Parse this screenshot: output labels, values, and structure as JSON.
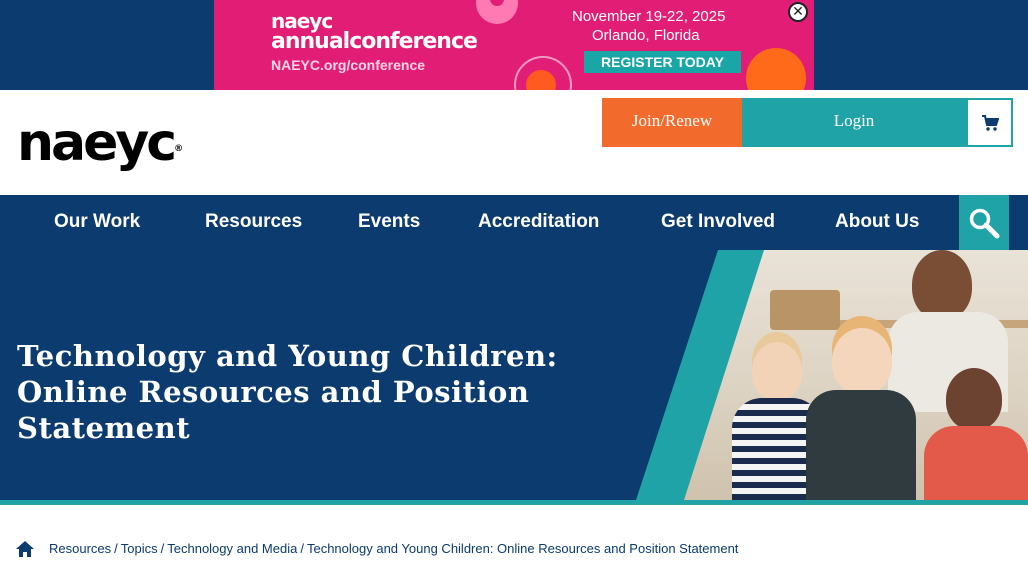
{
  "ad": {
    "brand_line1": "naeyc",
    "brand_line2_bold": "annual",
    "brand_line2_rest": "conference",
    "url": "NAEYC.org/conference",
    "date": "November 19-22, 2025",
    "location": "Orlando, Florida",
    "cta": "REGISTER TODAY",
    "close_glyph": "✕",
    "colors": {
      "bg": "#e21d75",
      "cta": "#1aa6a7"
    }
  },
  "header": {
    "brand": "naeyc",
    "brand_mark": "®",
    "join_label": "Join/Renew",
    "login_label": "Login",
    "cart_icon": "shopping-cart-icon"
  },
  "nav": {
    "items": [
      {
        "label": "Our Work"
      },
      {
        "label": "Resources"
      },
      {
        "label": "Events"
      },
      {
        "label": "Accreditation"
      },
      {
        "label": "Get Involved"
      },
      {
        "label": "About Us"
      }
    ],
    "search_icon": "search-icon"
  },
  "hero": {
    "title": "Technology and Young Children: Online Resources and Position Statement"
  },
  "breadcrumb": {
    "home_icon": "home-icon",
    "items": [
      {
        "label": "Resources"
      },
      {
        "label": "Topics"
      },
      {
        "label": "Technology and Media"
      },
      {
        "label": "Technology and Young Children: Online Resources and Position Statement"
      }
    ],
    "separator": "/"
  },
  "colors": {
    "navy": "#0b3b6f",
    "teal": "#20a3a6",
    "orange": "#f26a2c"
  }
}
